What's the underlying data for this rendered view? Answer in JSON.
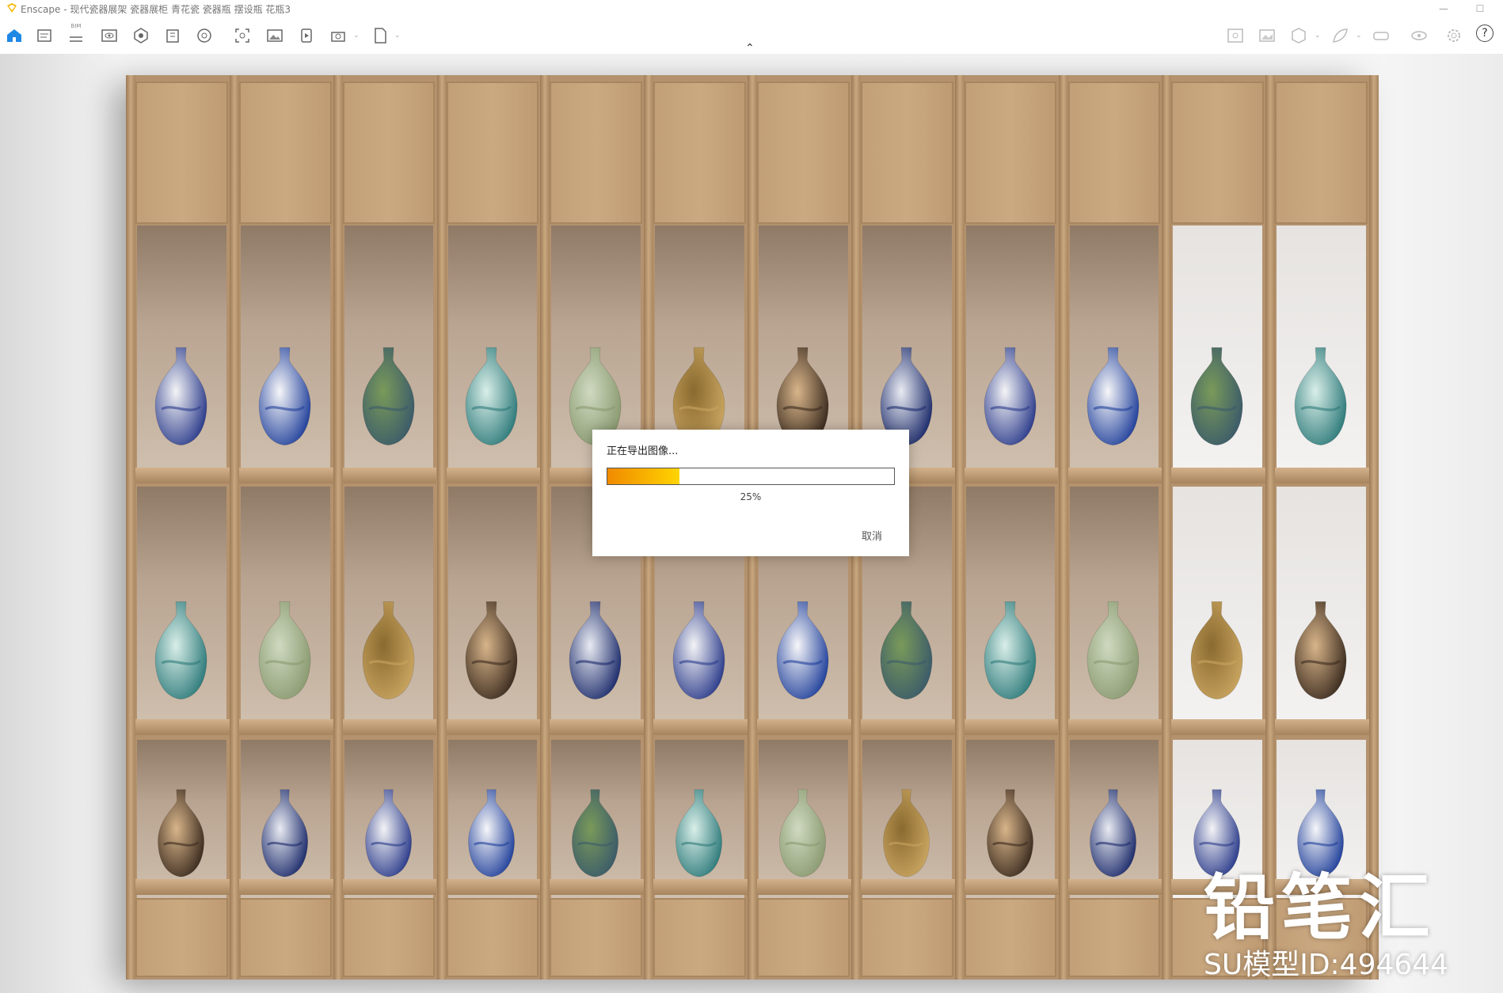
{
  "window": {
    "title": "Enscape - 现代瓷器展架 瓷器展柜 青花瓷 瓷器瓶 摆设瓶 花瓶3",
    "controls": [
      "—",
      "☐"
    ]
  },
  "toolbar": {
    "bim_label": "BIM",
    "icons": [
      "home-icon",
      "document-icon",
      "bim-icon",
      "eye-icon",
      "mesh-icon",
      "building-icon",
      "atom-icon",
      "screenshot-icon",
      "image-icon",
      "video-icon",
      "batch-icon",
      "export-icon",
      "grid-icon",
      "picture-icon",
      "cube-icon",
      "leaf-icon",
      "vr-icon",
      "eye-icon",
      "settings-icon",
      "help-icon"
    ],
    "help_label": "?",
    "dropdown_glyph": "⌄",
    "collapse_glyph": "⌃"
  },
  "dialog": {
    "title": "正在导出图像...",
    "progress": 0.25,
    "progress_text": "25%",
    "cancel_label": "取消"
  },
  "watermark": {
    "brand": "铅笔汇",
    "model_id": "SU模型ID:494644"
  },
  "colors": {
    "progress_start": "#f08a00",
    "progress_end": "#ffd400",
    "home_icon": "#1e88e5",
    "wood": "#b4926e"
  }
}
